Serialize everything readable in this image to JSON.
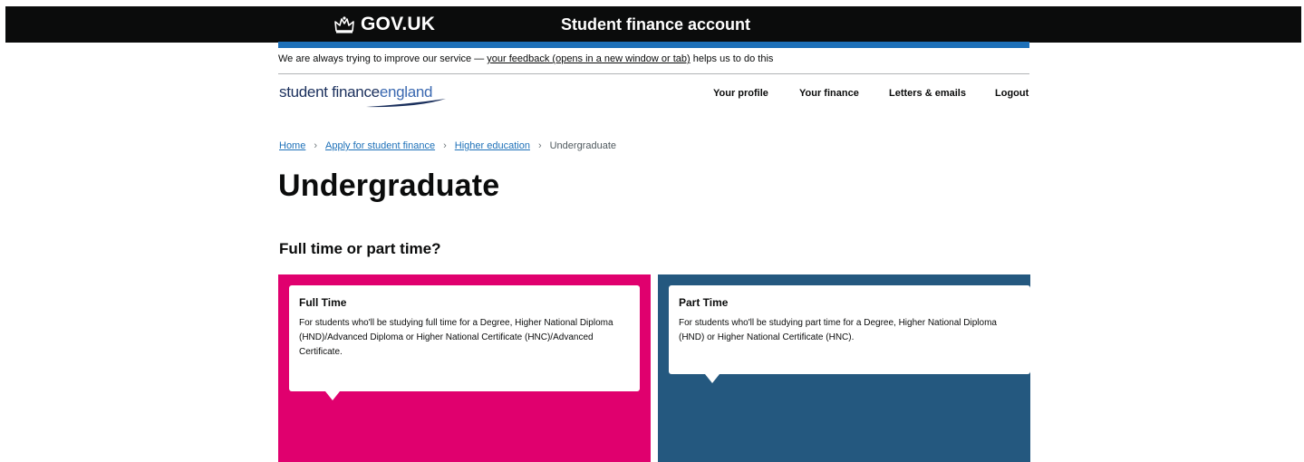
{
  "header": {
    "logo_text": "GOV.UK",
    "service_name": "Student finance account"
  },
  "feedback": {
    "prefix": "We are always trying to improve our service — ",
    "link": "your feedback (opens in a new window or tab)",
    "suffix": " helps us to do this"
  },
  "brand": {
    "part1": "student finance",
    "part2": "england"
  },
  "nav": {
    "items": [
      "Your profile",
      "Your finance",
      "Letters & emails",
      "Logout"
    ]
  },
  "breadcrumb": {
    "items": [
      "Home",
      "Apply for student finance",
      "Higher education"
    ],
    "current": "Undergraduate",
    "separator": "›"
  },
  "page": {
    "title": "Undergraduate",
    "question": "Full time or part time?"
  },
  "options": [
    {
      "title": "Full Time",
      "description": "For students who'll be studying full time for a Degree, Higher National Diploma (HND)/Advanced Diploma or Higher National Certificate (HNC)/Advanced Certificate.",
      "color": "#e0006e"
    },
    {
      "title": "Part Time",
      "description": "For students who'll be studying part time for a Degree, Higher National Diploma (HND) or Higher National Certificate (HNC).",
      "color": "#24587f"
    }
  ],
  "colors": {
    "header_bg": "#0b0c0c",
    "accent_blue": "#1d70b8"
  },
  "icons": {
    "crown": "crown-icon",
    "swoosh": "swoosh-icon"
  }
}
